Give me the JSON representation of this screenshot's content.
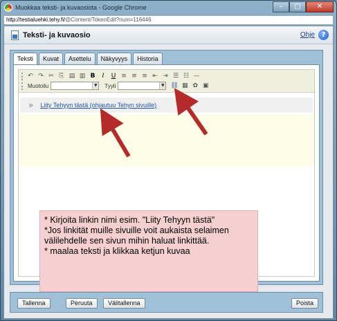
{
  "browser": {
    "window_title": "Muokkaa teksti- ja kuvaosiota - Google Chrome",
    "url_host": "http://testialuehki.tehy.fi/",
    "url_path": "@Content/TokenEdit?num=116446"
  },
  "dialog": {
    "title": "Teksti- ja kuvaosio",
    "help_label": "Ohje",
    "help_icon": "?"
  },
  "tabs": [
    {
      "label": "Teksti",
      "active": true
    },
    {
      "label": "Kuvat",
      "active": false
    },
    {
      "label": "Asettelu",
      "active": false
    },
    {
      "label": "Näkyvyys",
      "active": false
    },
    {
      "label": "Historia",
      "active": false
    }
  ],
  "toolbar": {
    "format_label": "Muotoilu",
    "style_label": "Tyyli",
    "format_value": "",
    "style_value": ""
  },
  "editor": {
    "link_chevron": "»",
    "link_text": "Liity Tehyyn tästä (ohjautuu Tehyn sivuille)"
  },
  "note": {
    "lines": [
      "* Kirjoita linkin nimi esim. \"Liity Tehyyn tästä\"",
      "*Jos linkität muille sivuille voit aukaista selaimen välilehdelle sen sivun mihin haluat linkittää.",
      "* maalaa teksti ja klikkaa ketjun kuvaa"
    ]
  },
  "footer": {
    "save_label": "Tallenna",
    "cancel_label": "Peruuta",
    "temp_save_label": "Välitallenna",
    "delete_label": "Poista"
  },
  "colors": {
    "annotation_arrow": "#b52a2a",
    "note_background": "#f6d0d0",
    "link_color": "#2255aa"
  }
}
